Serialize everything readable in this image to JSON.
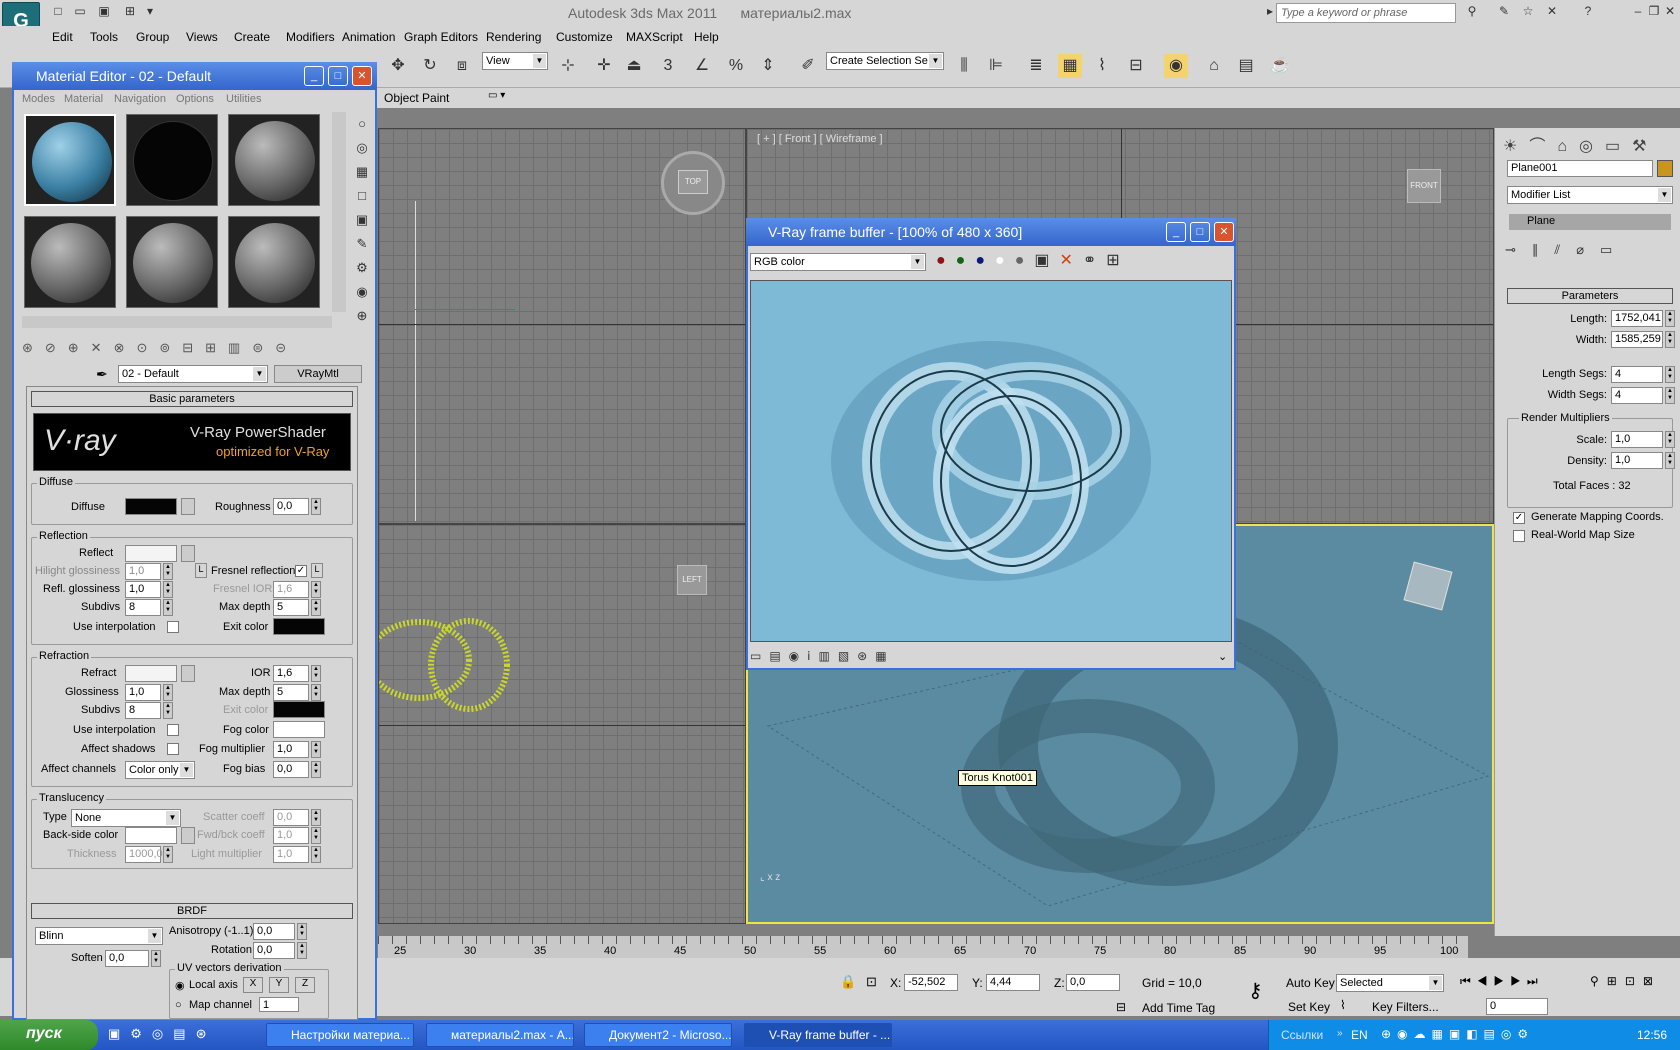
{
  "app": {
    "title": "Autodesk 3ds Max  2011",
    "file": "материалы2.max",
    "logo": "G",
    "search_placeholder": "Type a keyword or phrase"
  },
  "menu": [
    "Edit",
    "Tools",
    "Group",
    "Views",
    "Create",
    "Modifiers",
    "Animation",
    "Graph Editors",
    "Rendering",
    "Customize",
    "MAXScript",
    "Help"
  ],
  "toolbar": {
    "view_combo": "View",
    "selection_set": "Create Selection Se",
    "object_paint": "Object Paint"
  },
  "viewports": {
    "front_label": "[ + ] [ Front ] [ Wireframe ]",
    "top_cube": "TOP",
    "front_cube": "FRONT",
    "left_cube": "LEFT",
    "tooltip": "Torus Knot001"
  },
  "material_editor": {
    "title": "Material Editor - 02 - Default",
    "menus": [
      "Modes",
      "Material",
      "Navigation",
      "Options",
      "Utilities"
    ],
    "material_name": "02 - Default",
    "material_type": "VRayMtl",
    "basic_params": "Basic parameters",
    "banner_logo": "V·ray",
    "banner_title": "V-Ray PowerShader",
    "banner_sub": "optimized for V-Ray",
    "diffuse_group": "Diffuse",
    "diffuse_label": "Diffuse",
    "roughness_label": "Roughness",
    "roughness_value": "0,0",
    "reflection_group": "Reflection",
    "reflect_label": "Reflect",
    "hilight_label": "Hilight glossiness",
    "hilight_value": "1,0",
    "lock_l": "L",
    "fresnel_label": "Fresnel reflections",
    "refl_gloss_label": "Refl. glossiness",
    "refl_gloss_value": "1,0",
    "fresnel_ior_label": "Fresnel IOR",
    "fresnel_ior_value": "1,6",
    "subdivs_label": "Subdivs",
    "subdivs_value": "8",
    "max_depth_label": "Max depth",
    "max_depth_value": "5",
    "use_interp_label": "Use interpolation",
    "exit_color_label": "Exit color",
    "refraction_group": "Refraction",
    "refract_label": "Refract",
    "ior_label": "IOR",
    "ior_value": "1,6",
    "glossiness_label": "Glossiness",
    "glossiness_value": "1,0",
    "r_max_depth_value": "5",
    "r_subdivs_value": "8",
    "r_exit_color_label": "Exit color",
    "r_use_interp_label": "Use interpolation",
    "fog_color_label": "Fog color",
    "affect_shadows_label": "Affect shadows",
    "fog_mult_label": "Fog multiplier",
    "fog_mult_value": "1,0",
    "affect_channels_label": "Affect channels",
    "affect_channels_value": "Color only",
    "fog_bias_label": "Fog bias",
    "fog_bias_value": "0,0",
    "translucency_group": "Translucency",
    "type_label": "Type",
    "type_value": "None",
    "scatter_label": "Scatter coeff",
    "scatter_value": "0,0",
    "backside_label": "Back-side color",
    "fwdbck_label": "Fwd/bck coeff",
    "fwdbck_value": "1,0",
    "thickness_label": "Thickness",
    "thickness_value": "1000,0",
    "light_mult_label": "Light multiplier",
    "light_mult_value": "1,0",
    "brdf_head": "BRDF",
    "brdf_type": "Blinn",
    "anisotropy_label": "Anisotropy (-1..1)",
    "anisotropy_value": "0,0",
    "rotation_label": "Rotation",
    "rotation_value": "0,0",
    "soften_label": "Soften",
    "soften_value": "0,0",
    "uv_group": "UV vectors derivation",
    "local_axis": "Local axis",
    "axis_x": "X",
    "axis_y": "Y",
    "axis_z": "Z",
    "map_channel_label": "Map channel",
    "map_channel_value": "1"
  },
  "vfb": {
    "title": "V-Ray frame buffer - [100% of 480 x 360]",
    "channel": "RGB color"
  },
  "command_panel": {
    "object_name": "Plane001",
    "modifier_list": "Modifier List",
    "stack_item": "Plane",
    "params_head": "Parameters",
    "length_label": "Length:",
    "length_value": "1752,041",
    "width_label": "Width:",
    "width_value": "1585,259",
    "length_segs_label": "Length Segs:",
    "length_segs_value": "4",
    "width_segs_label": "Width Segs:",
    "width_segs_value": "4",
    "render_mult_label": "Render Multipliers",
    "scale_label": "Scale:",
    "scale_value": "1,0",
    "density_label": "Density:",
    "density_value": "1,0",
    "total_faces": "Total Faces : 32",
    "gen_mapping": "Generate Mapping Coords.",
    "real_world": "Real-World Map Size"
  },
  "timeline": {
    "ticks": [
      "25",
      "30",
      "35",
      "40",
      "45",
      "50",
      "55",
      "60",
      "65",
      "70",
      "75",
      "80",
      "85",
      "90",
      "95",
      "100"
    ]
  },
  "status": {
    "x_label": "X:",
    "x_value": "-52,502",
    "y_label": "Y:",
    "y_value": "4,44",
    "z_label": "Z:",
    "z_value": "0,0",
    "grid": "Grid = 10,0",
    "add_time_tag": "Add Time Tag",
    "auto_key": "Auto Key",
    "set_key": "Set Key",
    "selected": "Selected",
    "key_filters": "Key Filters...",
    "frame": "0"
  },
  "taskbar": {
    "start": "пуск",
    "tasks": [
      "Настройки материа...",
      "материалы2.max - А...",
      "Документ2 - Microso...",
      "V-Ray frame buffer - ..."
    ],
    "links": "Ссылки",
    "lang": "EN",
    "clock": "12:56"
  }
}
